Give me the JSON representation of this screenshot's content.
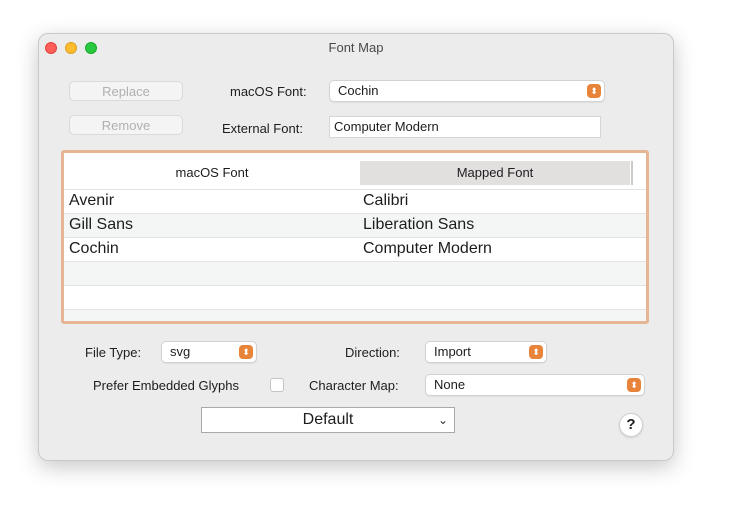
{
  "window": {
    "title": "Font Map"
  },
  "buttons": {
    "replace": "Replace",
    "remove": "Remove"
  },
  "mac_font": {
    "label": "macOS Font:",
    "value": "Cochin"
  },
  "external_font": {
    "label": "External Font:",
    "value": "Computer Modern"
  },
  "table": {
    "columns": [
      "macOS Font",
      "Mapped Font"
    ],
    "rows": [
      {
        "mac": "Avenir",
        "mapped": "Calibri"
      },
      {
        "mac": "Gill Sans",
        "mapped": "Liberation Sans"
      },
      {
        "mac": "Cochin",
        "mapped": "Computer Modern"
      }
    ]
  },
  "file_type": {
    "label": "File Type:",
    "value": "svg"
  },
  "direction": {
    "label": "Direction:",
    "value": "Import"
  },
  "prefer_glyphs": {
    "label": "Prefer Embedded Glyphs"
  },
  "character_map": {
    "label": "Character Map:",
    "value": "None"
  },
  "preset": {
    "value": "Default"
  },
  "help": {
    "glyph": "?"
  },
  "icons": {
    "stepper": "⬍",
    "chevron": "⌄"
  },
  "colors": {
    "accent": "#e8833a",
    "focus_ring": "#e6b593"
  }
}
